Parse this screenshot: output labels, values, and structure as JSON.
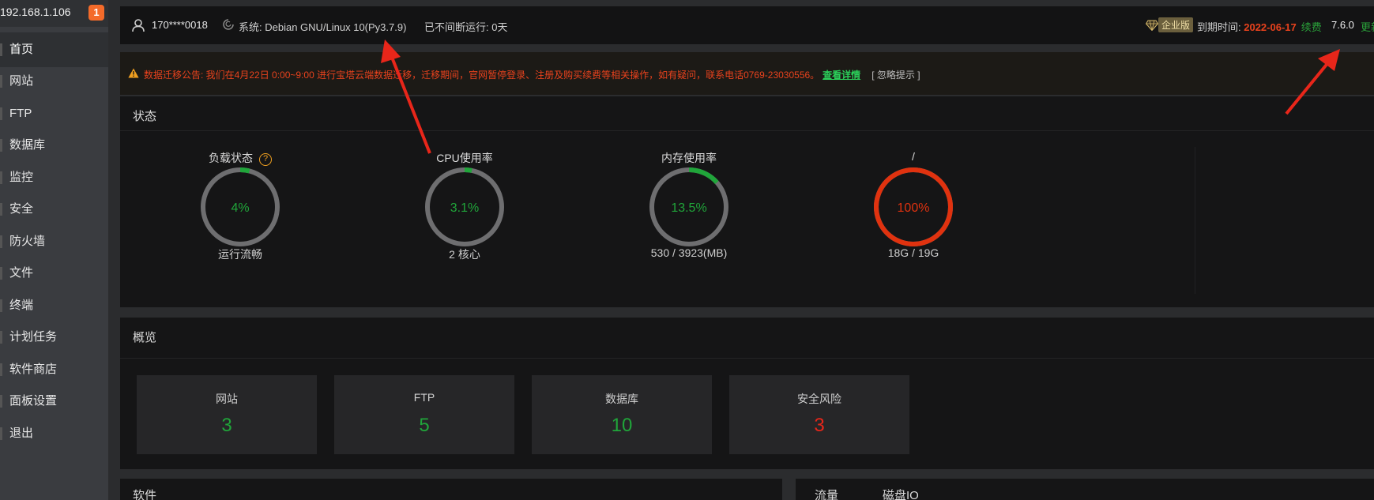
{
  "sidebar": {
    "ip": "192.168.1.106",
    "badge": "1",
    "items": [
      {
        "label": "首页"
      },
      {
        "label": "网站"
      },
      {
        "label": "FTP"
      },
      {
        "label": "数据库"
      },
      {
        "label": "监控"
      },
      {
        "label": "安全"
      },
      {
        "label": "防火墙"
      },
      {
        "label": "文件"
      },
      {
        "label": "终端"
      },
      {
        "label": "计划任务"
      },
      {
        "label": "软件商店"
      },
      {
        "label": "面板设置"
      },
      {
        "label": "退出"
      }
    ]
  },
  "header": {
    "user": "170****0018",
    "system": "系统:  Debian GNU/Linux 10(Py3.7.9)",
    "uptime": "已不间断运行: 0天",
    "edition": "企业版",
    "expire_label": "到期时间: ",
    "expire_date": "2022-06-17",
    "renew": "续费",
    "version": "7.6.0",
    "update": "更新"
  },
  "notice": {
    "text": "数据迁移公告: 我们在4月22日 0:00~9:00 进行宝塔云端数据迁移，迁移期间，官网暂停登录、注册及购买续费等相关操作，如有疑问，联系电话0769-23030556。",
    "link": "查看详情",
    "ignore": "[ 忽略提示 ]"
  },
  "status": {
    "title": "状态",
    "gauges": [
      {
        "label": "负载状态",
        "value": "4%",
        "fraction": 0.04,
        "sub": "运行流畅",
        "color": "#20a53a",
        "has_help": true
      },
      {
        "label": "CPU使用率",
        "value": "3.1%",
        "fraction": 0.031,
        "sub": "2 核心",
        "color": "#20a53a",
        "has_help": false
      },
      {
        "label": "内存使用率",
        "value": "13.5%",
        "fraction": 0.135,
        "sub": "530 / 3923(MB)",
        "color": "#20a53a",
        "has_help": false
      },
      {
        "label": "/",
        "value": "100%",
        "fraction": 1.0,
        "sub": "18G / 19G",
        "color": "#e0320f",
        "has_help": false
      }
    ]
  },
  "overview": {
    "title": "概览",
    "cards": [
      {
        "label": "网站",
        "value": "3",
        "color": "#20a53a"
      },
      {
        "label": "FTP",
        "value": "5",
        "color": "#20a53a"
      },
      {
        "label": "数据库",
        "value": "10",
        "color": "#20a53a"
      },
      {
        "label": "安全风险",
        "value": "3",
        "color": "#e8261a"
      }
    ]
  },
  "bottom": {
    "left_title": "软件",
    "right_tabs": [
      "流量",
      "磁盘IO"
    ]
  },
  "colors": {
    "accent_green": "#20a53a",
    "alert_red": "#e8421d"
  }
}
